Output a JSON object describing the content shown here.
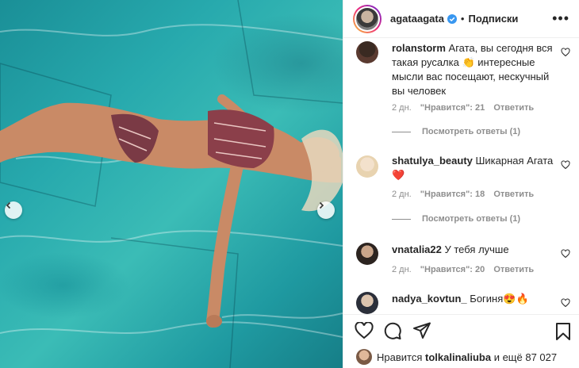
{
  "header": {
    "username": "agataagata",
    "dot": "•",
    "follow_label": "Подписки",
    "more_label": "•••"
  },
  "comments": [
    {
      "username": "rolanstorm",
      "text": "Агата, вы сегодня вся такая русалка 👏 интересные мысли вас посещают, нескучный вы человек",
      "time": "2 дн.",
      "likes": "\"Нравится\": 21",
      "reply": "Ответить",
      "view_replies": "Посмотреть ответы (1)"
    },
    {
      "username": "shatulya_beauty",
      "text": "Шикарная Агата ❤️",
      "time": "2 дн.",
      "likes": "\"Нравится\": 18",
      "reply": "Ответить",
      "view_replies": "Посмотреть ответы (1)"
    },
    {
      "username": "vnatalia22",
      "text": "У тебя лучше",
      "time": "2 дн.",
      "likes": "\"Нравится\": 20",
      "reply": "Ответить"
    },
    {
      "username": "nadya_kovtun_",
      "text": "Богиня😍🔥"
    }
  ],
  "likes_bar": {
    "prefix": "Нравится",
    "user": "tolkalinaliuba",
    "suffix": "и ещё 87 027"
  },
  "icons": [
    "verified-badge-icon",
    "more-options-icon",
    "heart-icon",
    "comment-icon",
    "share-icon",
    "bookmark-icon",
    "chevron-left-icon",
    "chevron-right-icon"
  ],
  "colors": {
    "text": "#262626",
    "muted": "#8e8e8e",
    "verified": "#3897f0",
    "divider": "#efefef"
  }
}
